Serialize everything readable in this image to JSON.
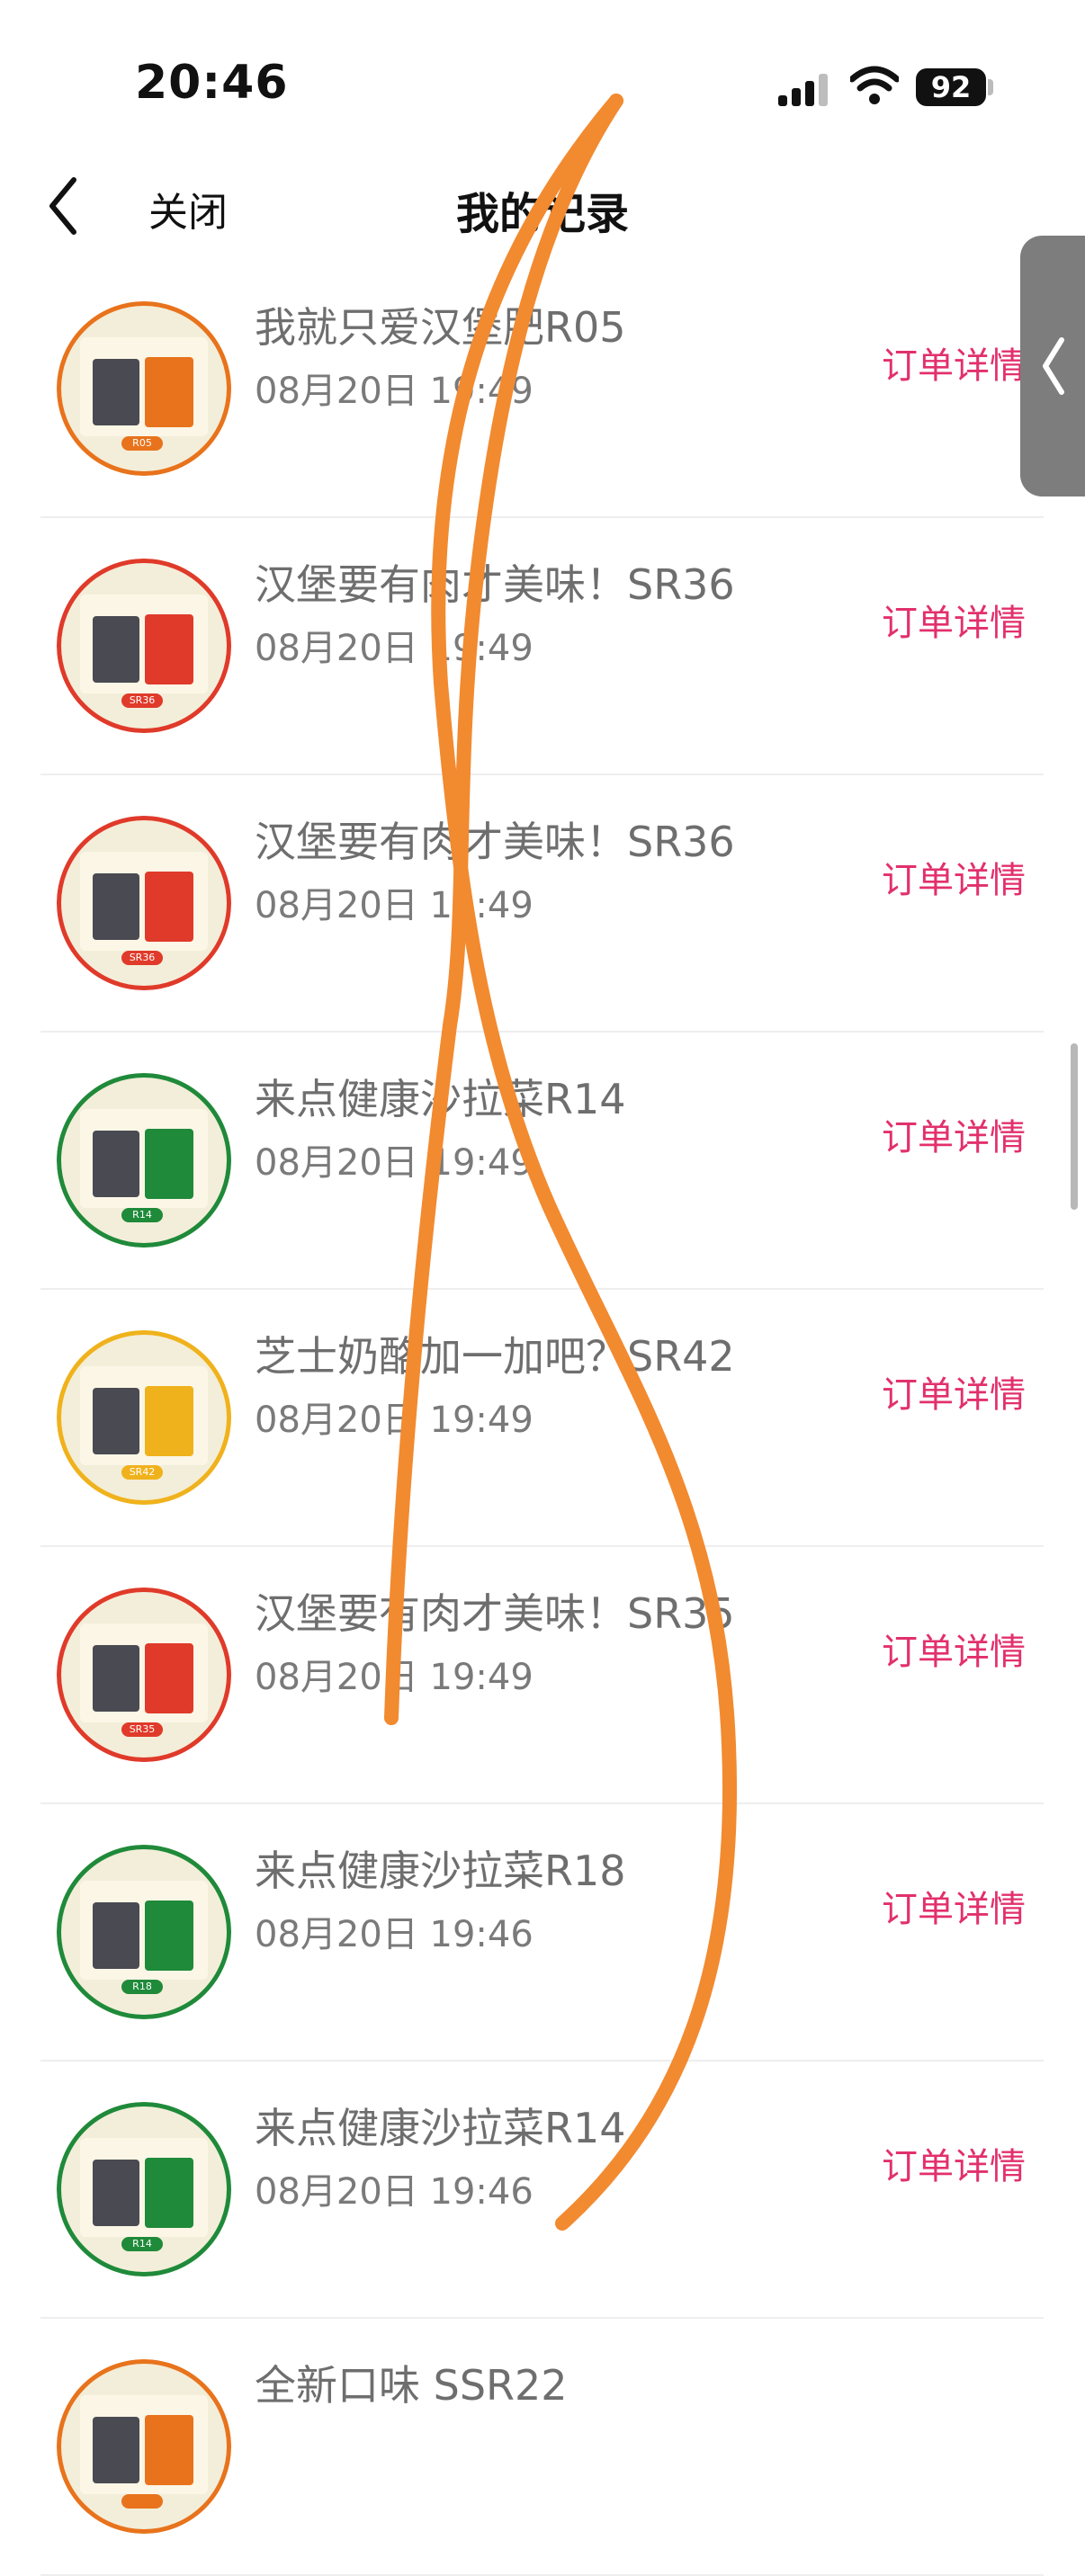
{
  "status_bar": {
    "time": "20:46",
    "battery": "92"
  },
  "nav": {
    "back_label": "关闭",
    "title": "我的记录"
  },
  "records": [
    {
      "title": "我就只爱汉堡肥R05",
      "time": "08月20日 19:49",
      "action": "订单详情",
      "code": "R05",
      "accent": "#e8731c"
    },
    {
      "title": "汉堡要有肉才美味！SR36",
      "time": "08月20日 19:49",
      "action": "订单详情",
      "code": "SR36",
      "accent": "#e03a2a"
    },
    {
      "title": "汉堡要有肉才美味！SR36",
      "time": "08月20日 19:49",
      "action": "订单详情",
      "code": "SR36",
      "accent": "#e03a2a"
    },
    {
      "title": "来点健康沙拉菜R14",
      "time": "08月20日 19:49",
      "action": "订单详情",
      "code": "R14",
      "accent": "#1f8a3a"
    },
    {
      "title": "芝士奶酪加一加吧？SR42",
      "time": "08月20日 19:49",
      "action": "订单详情",
      "code": "SR42",
      "accent": "#f0b21c"
    },
    {
      "title": "汉堡要有肉才美味！SR35",
      "time": "08月20日 19:49",
      "action": "订单详情",
      "code": "SR35",
      "accent": "#e03a2a"
    },
    {
      "title": "来点健康沙拉菜R18",
      "time": "08月20日 19:46",
      "action": "订单详情",
      "code": "R18",
      "accent": "#1f8a3a"
    },
    {
      "title": "来点健康沙拉菜R14",
      "time": "08月20日 19:46",
      "action": "订单详情",
      "code": "R14",
      "accent": "#1f8a3a"
    },
    {
      "title": "全新口味 SSR22",
      "time": "",
      "action": "",
      "code": "",
      "accent": "#e8731c"
    }
  ],
  "colors": {
    "action": "#e2306c",
    "scribble": "#f28a30"
  }
}
